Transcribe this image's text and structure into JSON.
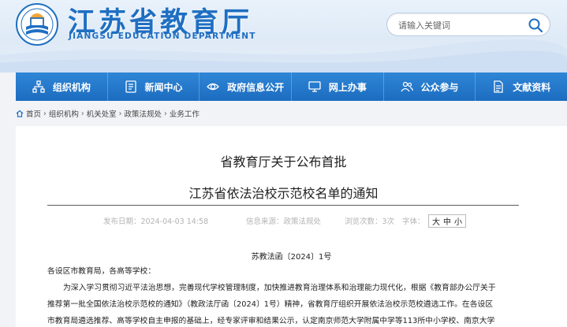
{
  "header": {
    "title": "江苏省教育厅",
    "subtitle": "JIANGSU EDUCATION DEPARTMENT",
    "search_placeholder": "请输入关键词"
  },
  "nav": {
    "items": [
      {
        "label": "组织机构",
        "icon": "org-chart-icon"
      },
      {
        "label": "新闻中心",
        "icon": "news-icon"
      },
      {
        "label": "政府信息公开",
        "icon": "info-disclosure-icon"
      },
      {
        "label": "网上办事",
        "icon": "online-service-icon"
      },
      {
        "label": "公众参与",
        "icon": "public-participation-icon"
      },
      {
        "label": "文献资料",
        "icon": "documents-icon"
      }
    ]
  },
  "breadcrumb": [
    "首页",
    "组织机构",
    "机关处室",
    "政策法规处",
    "业务工作"
  ],
  "article": {
    "title_line1": "省教育厅关于公布首批",
    "title_line2": "江苏省依法治校示范校名单的通知",
    "publish_time": "发布日期：2024-04-03 14:58",
    "source": "信息来源：政策法规处",
    "views": "浏览次数：3次",
    "font_label": "字体：",
    "font_big": "大",
    "font_mid": "中",
    "font_small": "小",
    "doc_number": "苏教法函〔2024〕1号",
    "salutation": "各设区市教育局，各高等学校：",
    "p1_line1": "为深入学习贯彻习近平法治思想，完善现代学校管理制度，加快推进教育治理体系和治理能力现代化，根据《教育部办公厅关于",
    "p1_line2": "推荐第一批全国依法治校示范校的通知》（教政法厅函〔2024〕1号）精神，省教育厅组织开展依法治校示范校遴选工作。在各设区",
    "p1_line3": "市教育局遴选推荐、高等学校自主申报的基础上，经专家评审和结果公示，认定南京师范大学附属中学等113所中小学校、南京大学"
  },
  "colors": {
    "brand_blue": "#1f6fc2",
    "nav_blue": "#2378cc"
  }
}
